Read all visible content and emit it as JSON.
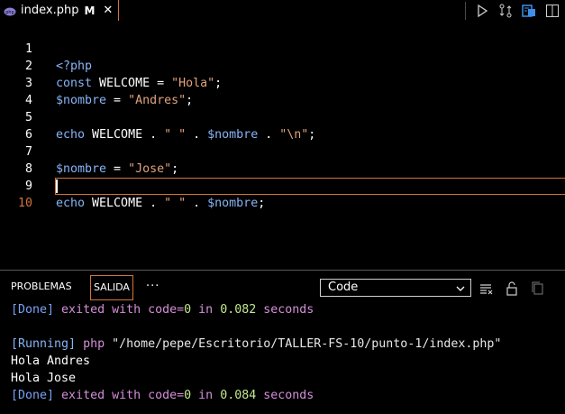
{
  "tab": {
    "filename": "index.php",
    "modified": "M",
    "close": "✕"
  },
  "editor": {
    "lines": [
      {
        "n": "1",
        "t": "<?php"
      },
      {
        "n": "2",
        "t": "const WELCOME = \"Hola\";"
      },
      {
        "n": "3",
        "t": "$nombre = \"Andres\";"
      },
      {
        "n": "4",
        "t": ""
      },
      {
        "n": "5",
        "t": "echo WELCOME . \" \" . $nombre . \"\\n\";"
      },
      {
        "n": "6",
        "t": ""
      },
      {
        "n": "7",
        "t": "$nombre = \"Jose\";"
      },
      {
        "n": "8",
        "t": ""
      },
      {
        "n": "9",
        "t": "echo WELCOME . \" \" . $nombre;"
      },
      {
        "n": "10",
        "t": ""
      }
    ]
  },
  "panel": {
    "tabs": [
      "PROBLEMAS",
      "SALIDA"
    ],
    "active_tab": "SALIDA",
    "more": "···",
    "select_value": "Code",
    "output": {
      "l1": {
        "tag": "[Done]",
        "a": " exited with ",
        "b": "code=",
        "c": "0",
        "d": " in ",
        "e": "0.082",
        "f": " seconds"
      },
      "l2": {
        "tag": "[Running]",
        "cmd": " php ",
        "path": "\"/home/pepe/Escritorio/TALLER-FS-10/punto-1/index.php\""
      },
      "l3": "Hola Andres",
      "l4": "Hola Jose",
      "l5": {
        "tag": "[Done]",
        "a": " exited with ",
        "b": "code=",
        "c": "0",
        "d": " in ",
        "e": "0.084",
        "f": " seconds"
      }
    }
  },
  "colors": {
    "accent": "#d4733a",
    "keyword": "#88b4f5",
    "string": "#e0a37b"
  },
  "icons": [
    "php-file-icon",
    "run-icon",
    "compare-changes-icon",
    "open-preview-icon",
    "split-editor-icon",
    "chevron-down-icon",
    "clear-output-icon",
    "lock-scroll-icon",
    "copy-icon"
  ]
}
